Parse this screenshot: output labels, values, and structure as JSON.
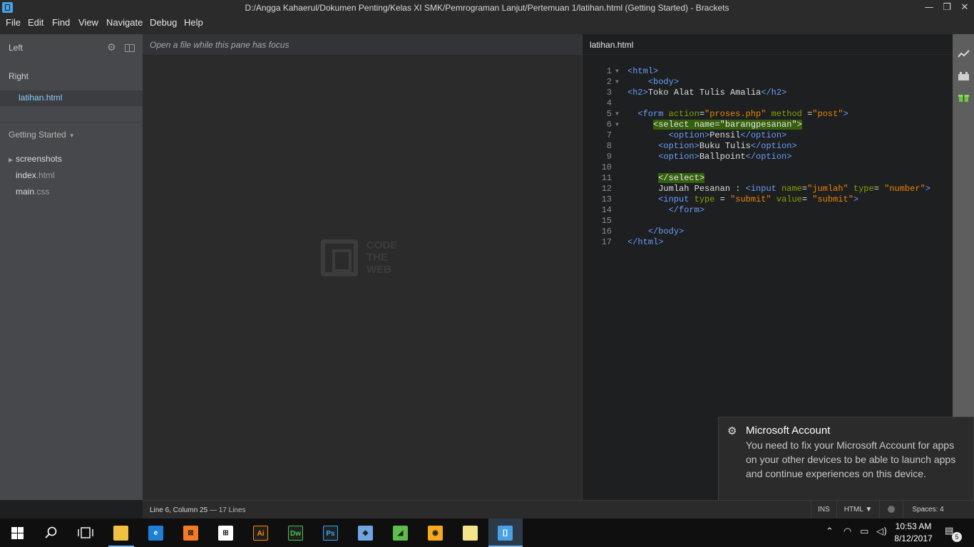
{
  "window": {
    "title": "D:/Angga Kahaerul/Dokumen Penting/Kelas XI SMK/Pemrograman Lanjut/Pertemuan 1/latihan.html (Getting Started) - Brackets"
  },
  "menu": [
    "File",
    "Edit",
    "Find",
    "View",
    "Navigate",
    "Debug",
    "Help"
  ],
  "sidebar": {
    "left_label": "Left",
    "right_label": "Right",
    "working_file": "latihan.html",
    "project_name": "Getting Started",
    "tree": [
      {
        "name": "screenshots",
        "type": "folder"
      },
      {
        "base": "index",
        "ext": ".html",
        "type": "file"
      },
      {
        "base": "main",
        "ext": ".css",
        "type": "file"
      }
    ]
  },
  "left_pane": {
    "placeholder": "Open a file while this pane has focus",
    "logo_lines": [
      "CODE",
      "THE",
      "WEB"
    ]
  },
  "right_pane": {
    "filename": "latihan.html"
  },
  "code_lines": [
    {
      "n": "1",
      "fold": true,
      "tokens": [
        [
          "t",
          "<html>"
        ]
      ]
    },
    {
      "n": "2",
      "fold": true,
      "tokens": [
        [
          "x",
          "    "
        ],
        [
          "t",
          "<body>"
        ]
      ]
    },
    {
      "n": "3",
      "fold": false,
      "tokens": [
        [
          "t",
          "<h2>"
        ],
        [
          "x",
          "Toko Alat Tulis Amalia"
        ],
        [
          "t",
          "</h2>"
        ]
      ]
    },
    {
      "n": "4",
      "fold": false,
      "tokens": []
    },
    {
      "n": "5",
      "fold": true,
      "tokens": [
        [
          "x",
          "  "
        ],
        [
          "t",
          "<form "
        ],
        [
          "a",
          "action"
        ],
        [
          "x",
          "="
        ],
        [
          "s",
          "\"proses.php\""
        ],
        [
          "x",
          " "
        ],
        [
          "a",
          "method"
        ],
        [
          "x",
          " ="
        ],
        [
          "s",
          "\"post\""
        ],
        [
          "t",
          ">"
        ]
      ]
    },
    {
      "n": "6",
      "fold": true,
      "tokens": [
        [
          "x",
          "     "
        ],
        [
          "h",
          "<select name=\"barangpesanan\">"
        ]
      ]
    },
    {
      "n": "7",
      "fold": false,
      "tokens": [
        [
          "x",
          "        "
        ],
        [
          "t",
          "<option>"
        ],
        [
          "x",
          "Pensil"
        ],
        [
          "t",
          "</option>"
        ]
      ]
    },
    {
      "n": "8",
      "fold": false,
      "tokens": [
        [
          "x",
          "      "
        ],
        [
          "t",
          "<option>"
        ],
        [
          "x",
          "Buku Tulis"
        ],
        [
          "t",
          "</option>"
        ]
      ]
    },
    {
      "n": "9",
      "fold": false,
      "tokens": [
        [
          "x",
          "      "
        ],
        [
          "t",
          "<option>"
        ],
        [
          "x",
          "Ballpoint"
        ],
        [
          "t",
          "</option>"
        ]
      ]
    },
    {
      "n": "10",
      "fold": false,
      "tokens": []
    },
    {
      "n": "11",
      "fold": false,
      "tokens": [
        [
          "x",
          "      "
        ],
        [
          "h",
          "</select>"
        ]
      ]
    },
    {
      "n": "12",
      "fold": false,
      "tokens": [
        [
          "x",
          "      Jumlah Pesanan : "
        ],
        [
          "t",
          "<input "
        ],
        [
          "a",
          "name"
        ],
        [
          "x",
          "="
        ],
        [
          "s",
          "\"jumlah\""
        ],
        [
          "x",
          " "
        ],
        [
          "a",
          "type"
        ],
        [
          "x",
          "= "
        ],
        [
          "s",
          "\"number\""
        ],
        [
          "t",
          ">"
        ]
      ]
    },
    {
      "n": "13",
      "fold": false,
      "tokens": [
        [
          "x",
          "      "
        ],
        [
          "t",
          "<input "
        ],
        [
          "a",
          "type"
        ],
        [
          "x",
          " = "
        ],
        [
          "s",
          "\"submit\""
        ],
        [
          "x",
          " "
        ],
        [
          "a",
          "value"
        ],
        [
          "x",
          "= "
        ],
        [
          "s",
          "\"submit\""
        ],
        [
          "t",
          ">"
        ]
      ]
    },
    {
      "n": "14",
      "fold": false,
      "tokens": [
        [
          "x",
          "        "
        ],
        [
          "t",
          "</form>"
        ]
      ]
    },
    {
      "n": "15",
      "fold": false,
      "tokens": []
    },
    {
      "n": "16",
      "fold": false,
      "tokens": [
        [
          "x",
          "    "
        ],
        [
          "t",
          "</body>"
        ]
      ]
    },
    {
      "n": "17",
      "fold": false,
      "tokens": [
        [
          "t",
          "</html>"
        ]
      ]
    }
  ],
  "status": {
    "cursor": "Line 6, Column 25",
    "lines": "— 17 Lines",
    "mode": "INS",
    "language": "HTML",
    "spaces": "Spaces: 4"
  },
  "toast": {
    "title": "Microsoft Account",
    "body": "You need to fix your Microsoft Account for apps on your other devices to be able to launch apps and continue experiences on this device."
  },
  "taskbar": {
    "time": "10:53 AM",
    "date": "8/12/2017",
    "notification_count": "5",
    "apps": [
      {
        "name": "file-explorer-icon",
        "label": "",
        "color": "#f0c040",
        "running": true
      },
      {
        "name": "edge-icon",
        "label": "e",
        "color": "#1e7fd6",
        "running": false
      },
      {
        "name": "xampp-icon",
        "label": "⊠",
        "color": "#f57b24",
        "running": false
      },
      {
        "name": "store-icon",
        "label": "⊞",
        "color": "#ffffff",
        "running": false
      },
      {
        "name": "illustrator-icon",
        "label": "Ai",
        "color": "#ff8a00",
        "running": false
      },
      {
        "name": "dreamweaver-icon",
        "label": "Dw",
        "color": "#45c34a",
        "running": false
      },
      {
        "name": "photoshop-icon",
        "label": "Ps",
        "color": "#31a8ff",
        "running": false
      },
      {
        "name": "virtualbox-icon",
        "label": "◆",
        "color": "#6fa6e0",
        "running": false
      },
      {
        "name": "corel-icon",
        "label": "◢",
        "color": "#5cbd4b",
        "running": false
      },
      {
        "name": "uc-browser-icon",
        "label": "◉",
        "color": "#f7a81c",
        "running": false
      },
      {
        "name": "sticky-notes-icon",
        "label": "",
        "color": "#f4e58a",
        "running": false
      },
      {
        "name": "brackets-icon",
        "label": "[]",
        "color": "#4aa0e6",
        "running": true,
        "active": true
      }
    ]
  }
}
